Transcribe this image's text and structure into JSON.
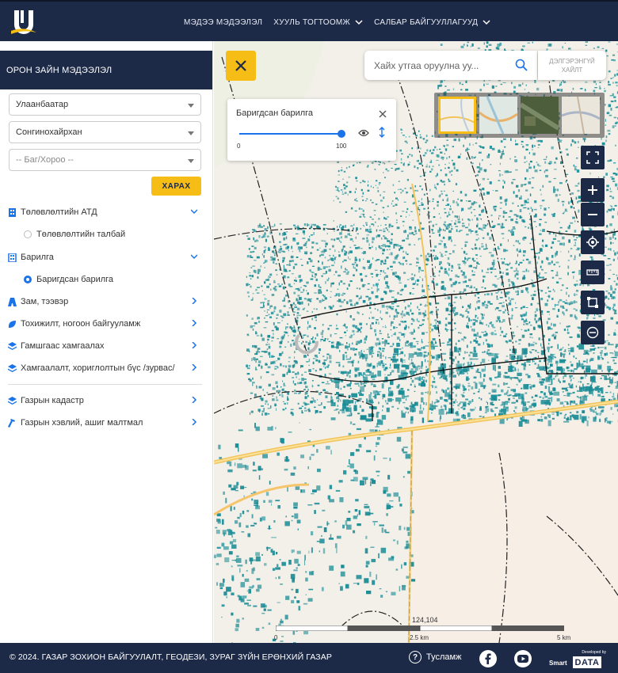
{
  "header": {
    "nav": [
      {
        "label": "МЭДЭЭ МЭДЭЭЛЭЛ",
        "dropdown": false
      },
      {
        "label": "ХУУЛЬ ТОГТООМЖ",
        "dropdown": true
      },
      {
        "label": "САЛБАР БАЙГУУЛЛАГУУД",
        "dropdown": true
      }
    ]
  },
  "sidebar": {
    "title": "ОРОН ЗАЙН МЭДЭЭЛЭЛ",
    "city_select": "Улаанбаатар",
    "district_select": "Сонгинохайрхан",
    "khoroo_placeholder": "-- Баг/Хороо --",
    "view_button": "ХАРАХ",
    "layers": [
      {
        "label": "Төлөвлөлтийн АТД",
        "icon": "building-plan-icon",
        "expanded": true
      },
      {
        "label": "Барилга",
        "icon": "building-icon",
        "expanded": true
      },
      {
        "label": "Зам, тээвэр",
        "icon": "road-icon",
        "expanded": false
      },
      {
        "label": "Тохижилт, ногоон байгууламж",
        "icon": "leaf-icon",
        "expanded": false
      },
      {
        "label": "Гамшгаас хамгаалах",
        "icon": "layers-icon",
        "expanded": false
      },
      {
        "label": "Хамгаалалт, хориглолтын бүс /зурвас/",
        "icon": "layers-icon",
        "expanded": false
      },
      {
        "label": "Газрын кадастр",
        "icon": "layers-icon",
        "expanded": false
      },
      {
        "label": "Газрын хэвлий, ашиг малтмал",
        "icon": "hammer-icon",
        "expanded": false
      }
    ],
    "sublayers": {
      "planning_area": {
        "label": "Төлөвлөлтийн талбай",
        "selected": false
      },
      "built_buildings": {
        "label": "Баригдсан барилга",
        "selected": true
      }
    }
  },
  "map": {
    "search_placeholder": "Хайх утгаа оруулна уу...",
    "advanced_search": "ДЭЛГЭРЭНГҮЙ ХАЙЛТ",
    "layer_panel": {
      "title": "Баригдсан барилга",
      "opacity_min": "0",
      "opacity_max": "100",
      "opacity_value": 100
    },
    "coordinate": "124,104",
    "scale_labels": [
      "0",
      "2.5 km",
      "5 km"
    ],
    "building_color": "#1a8c96",
    "accent_color": "#f6bd16",
    "navy_color": "#1d2a47"
  },
  "footer": {
    "copyright": "© 2024. ГАЗАР ЗОХИОН БАЙГУУЛАЛТ, ГЕОДЕЗИ, ЗУРАГ ЗҮЙН ЕРӨНХИЙ ГАЗАР",
    "help": "Тусламж",
    "brand_developed": "Developed by",
    "brand_smart": "Smart",
    "brand_data": "DATA"
  }
}
